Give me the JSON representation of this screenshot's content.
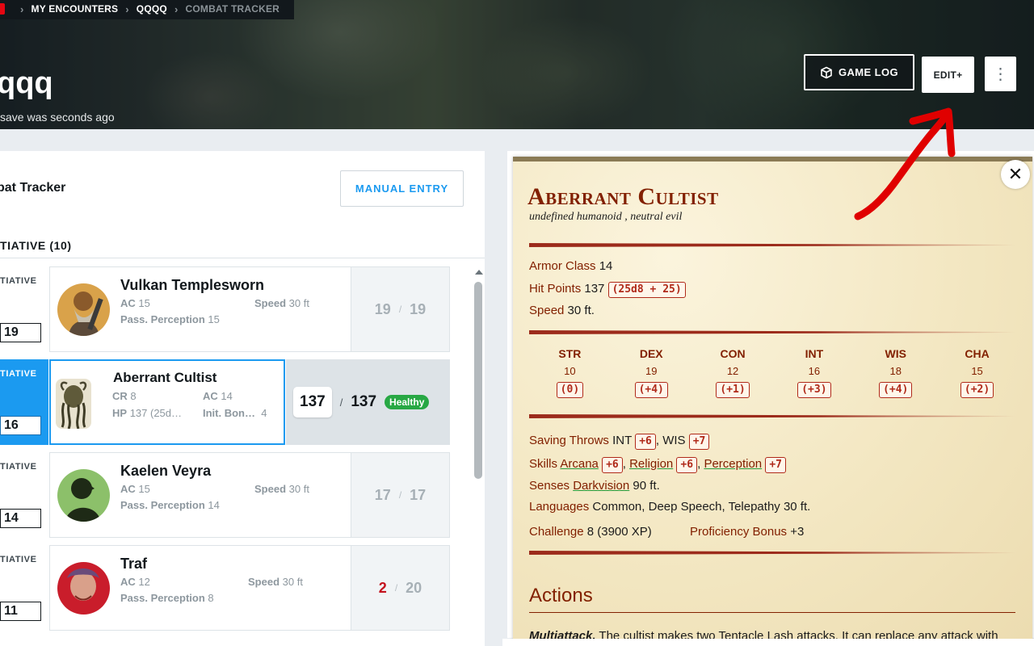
{
  "breadcrumb": {
    "items": [
      "MY ENCOUNTERS",
      "QQQQ",
      "COMBAT TRACKER"
    ]
  },
  "encounter": {
    "title": "qqq",
    "save_status": "save was seconds ago"
  },
  "header_buttons": {
    "game_log": "GAME LOG",
    "edit": "EDIT+",
    "more": "⋮"
  },
  "tracker": {
    "title": "bat Tracker",
    "manual_entry": "MANUAL ENTRY",
    "initiative_header": "TIATIVE (10)",
    "init_label": "TIATIVE"
  },
  "combatants": [
    {
      "name": "Vulkan Templesworn",
      "ac_label": "AC",
      "ac": "15",
      "speed_label": "Speed",
      "speed": "30 ft",
      "pp_label": "Pass. Perception",
      "pp": "15",
      "hp_current": "19",
      "hp_max": "19",
      "initiative": "19"
    },
    {
      "name": "Aberrant Cultist",
      "cr_label": "CR",
      "cr": "8",
      "ac_label": "AC",
      "ac": "14",
      "hp_label": "HP",
      "hp_text": "137 (25d…",
      "init_bonus_label": "Init. Bon…",
      "init_bonus": "4",
      "hp_current": "137",
      "hp_max": "137",
      "status": "Healthy",
      "initiative": "16"
    },
    {
      "name": "Kaelen Veyra",
      "ac_label": "AC",
      "ac": "15",
      "speed_label": "Speed",
      "speed": "30 ft",
      "pp_label": "Pass. Perception",
      "pp": "14",
      "hp_current": "17",
      "hp_max": "17",
      "initiative": "14"
    },
    {
      "name": "Traf",
      "ac_label": "AC",
      "ac": "12",
      "speed_label": "Speed",
      "speed": "30 ft",
      "pp_label": "Pass. Perception",
      "pp": "8",
      "hp_current": "2",
      "hp_max": "20",
      "initiative": "11"
    }
  ],
  "hp_slash": "/",
  "statblock": {
    "name": "Aberrant Cultist",
    "type": "undefined humanoid , neutral evil",
    "armor_class_label": "Armor Class",
    "armor_class": "14",
    "hit_points_label": "Hit Points",
    "hit_points": "137",
    "hit_dice": "(25d8 + 25)",
    "speed_label": "Speed",
    "speed": "30 ft.",
    "abilities": [
      {
        "name": "STR",
        "score": "10",
        "mod": "(0)"
      },
      {
        "name": "DEX",
        "score": "19",
        "mod": "(+4)"
      },
      {
        "name": "CON",
        "score": "12",
        "mod": "(+1)"
      },
      {
        "name": "INT",
        "score": "16",
        "mod": "(+3)"
      },
      {
        "name": "WIS",
        "score": "18",
        "mod": "(+4)"
      },
      {
        "name": "CHA",
        "score": "15",
        "mod": "(+2)"
      }
    ],
    "saving_throws_label": "Saving Throws",
    "save_int": "INT",
    "save_int_mod": "+6",
    "save_wis": "WIS",
    "save_wis_mod": "+7",
    "skills_label": "Skills",
    "skill_arcana": "Arcana",
    "skill_arcana_mod": "+6",
    "skill_religion": "Religion",
    "skill_religion_mod": "+6",
    "skill_perception": "Perception",
    "skill_perception_mod": "+7",
    "senses_label": "Senses",
    "senses_link": "Darkvision",
    "senses_value": "90 ft.",
    "languages_label": "Languages",
    "languages": "Common, Deep Speech, Telepathy 30 ft.",
    "challenge_label": "Challenge",
    "challenge": "8 (3900 XP)",
    "prof_label": "Proficiency Bonus",
    "prof": "+3",
    "actions_title": "Actions",
    "multiattack_name": "Multiattack.",
    "multiattack_text": "The cultist makes two Tentacle Lash attacks. It can replace any attack with"
  },
  "colors": {
    "accent": "#1b9af0",
    "healthy": "#27a844",
    "statblock_red": "#822000",
    "annotation": "#e00000"
  }
}
